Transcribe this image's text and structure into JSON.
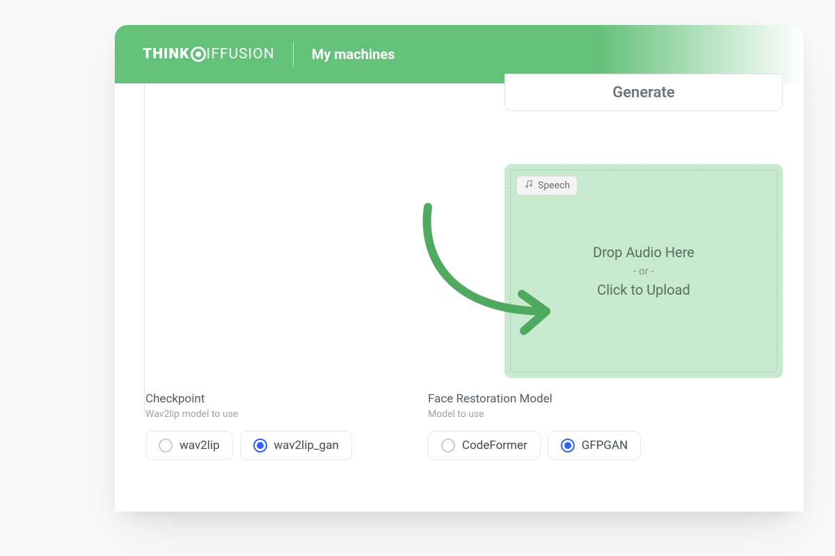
{
  "header": {
    "brand_think": "THINK",
    "brand_diffusion": "IFFUSION",
    "nav_title": "My machines"
  },
  "generate_button": {
    "label": "Generate"
  },
  "dropzone": {
    "chip_label": "Speech",
    "line1": "Drop Audio Here",
    "or": "- or -",
    "line2": "Click to Upload"
  },
  "checkpoint": {
    "title": "Checkpoint",
    "subtitle": "Wav2lip model to use",
    "options": [
      {
        "label": "wav2lip",
        "selected": false
      },
      {
        "label": "wav2lip_gan",
        "selected": true
      }
    ]
  },
  "face_restoration": {
    "title": "Face Restoration Model",
    "subtitle": "Model to use",
    "options": [
      {
        "label": "CodeFormer",
        "selected": false
      },
      {
        "label": "GFPGAN",
        "selected": true
      }
    ]
  },
  "colors": {
    "brand_green": "#63c17a",
    "accent_blue": "#2e62ff",
    "drop_bg": "#c7e9cd"
  }
}
